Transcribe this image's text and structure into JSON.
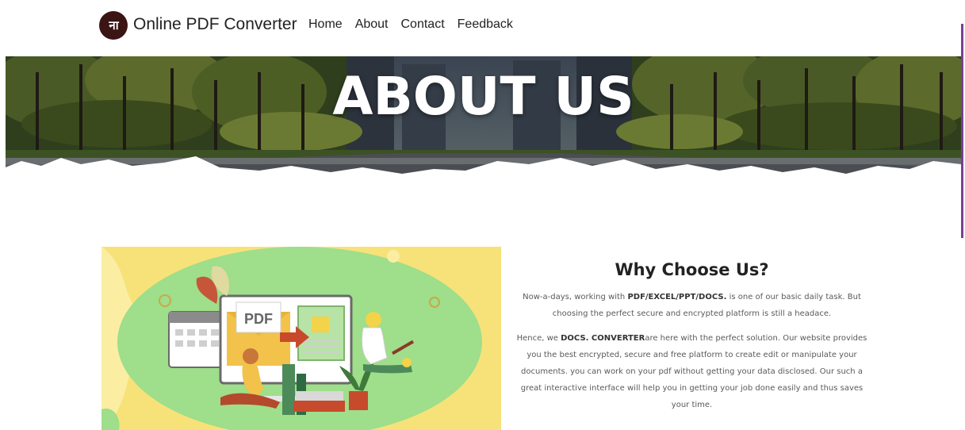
{
  "header": {
    "logo_text": "ना",
    "brand": "Online PDF Converter",
    "nav": [
      "Home",
      "About",
      "Contact",
      "Feedback"
    ]
  },
  "hero": {
    "title": "ABOUT US"
  },
  "illustration": {
    "doc_label": "PDF"
  },
  "why": {
    "heading": "Why Choose Us?",
    "p1_pre": "Now-a-days, working with ",
    "p1_bold": "PDF/EXCEL/PPT/DOCS.",
    "p1_post": " is one of our basic daily task. But choosing the perfect secure and encrypted platform is still a headace.",
    "p2_pre": "Hence, we ",
    "p2_bold": "DOCS. CONVERTER",
    "p2_post": "are here with the perfect solution. Our website provides you the best encrypted, secure and free platform to create edit or manipulate your documents. you can work on your pdf without getting your data disclosed. Our such a great interactive interface will help you in getting your job done easily and thus saves your time."
  },
  "colors": {
    "accent": "#7a3f95",
    "logo_bg": "#3b1414",
    "illus_yellow": "#f7e27a",
    "illus_green": "#9fde8a"
  }
}
